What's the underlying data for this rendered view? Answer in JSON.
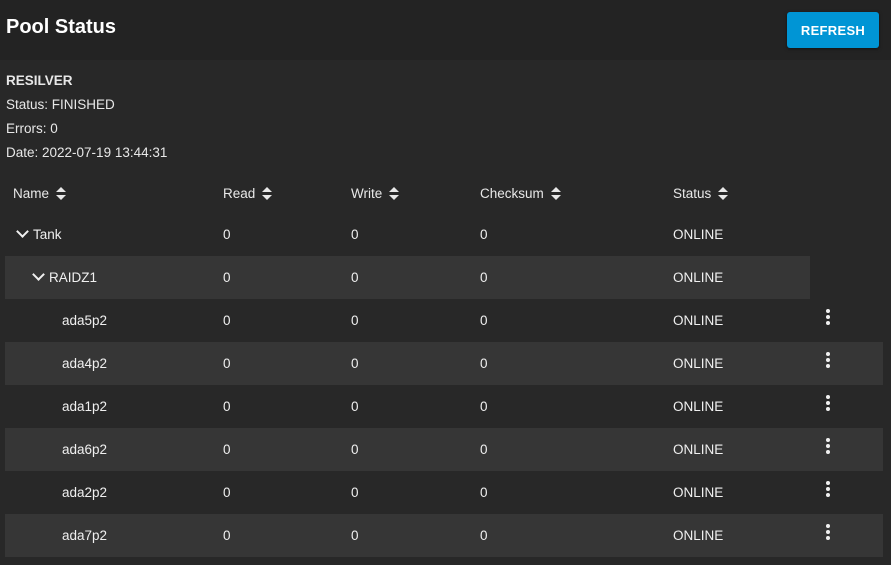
{
  "header": {
    "title": "Pool Status",
    "refresh_label": "REFRESH",
    "accent_color": "#0095d5"
  },
  "scan": {
    "heading": "RESILVER",
    "status": "Status: FINISHED",
    "errors": "Errors: 0",
    "date": "Date: 2022-07-19 13:44:31"
  },
  "table": {
    "columns": [
      "Name",
      "Read",
      "Write",
      "Checksum",
      "Status"
    ],
    "rows": [
      {
        "name": "Tank",
        "read": "0",
        "write": "0",
        "checksum": "0",
        "status": "ONLINE",
        "expandable": true,
        "actions": false
      },
      {
        "name": "RAIDZ1",
        "read": "0",
        "write": "0",
        "checksum": "0",
        "status": "ONLINE",
        "expandable": true,
        "actions": false
      },
      {
        "name": "ada5p2",
        "read": "0",
        "write": "0",
        "checksum": "0",
        "status": "ONLINE",
        "expandable": false,
        "actions": true
      },
      {
        "name": "ada4p2",
        "read": "0",
        "write": "0",
        "checksum": "0",
        "status": "ONLINE",
        "expandable": false,
        "actions": true
      },
      {
        "name": "ada1p2",
        "read": "0",
        "write": "0",
        "checksum": "0",
        "status": "ONLINE",
        "expandable": false,
        "actions": true
      },
      {
        "name": "ada6p2",
        "read": "0",
        "write": "0",
        "checksum": "0",
        "status": "ONLINE",
        "expandable": false,
        "actions": true
      },
      {
        "name": "ada2p2",
        "read": "0",
        "write": "0",
        "checksum": "0",
        "status": "ONLINE",
        "expandable": false,
        "actions": true
      },
      {
        "name": "ada7p2",
        "read": "0",
        "write": "0",
        "checksum": "0",
        "status": "ONLINE",
        "expandable": false,
        "actions": true
      }
    ]
  }
}
